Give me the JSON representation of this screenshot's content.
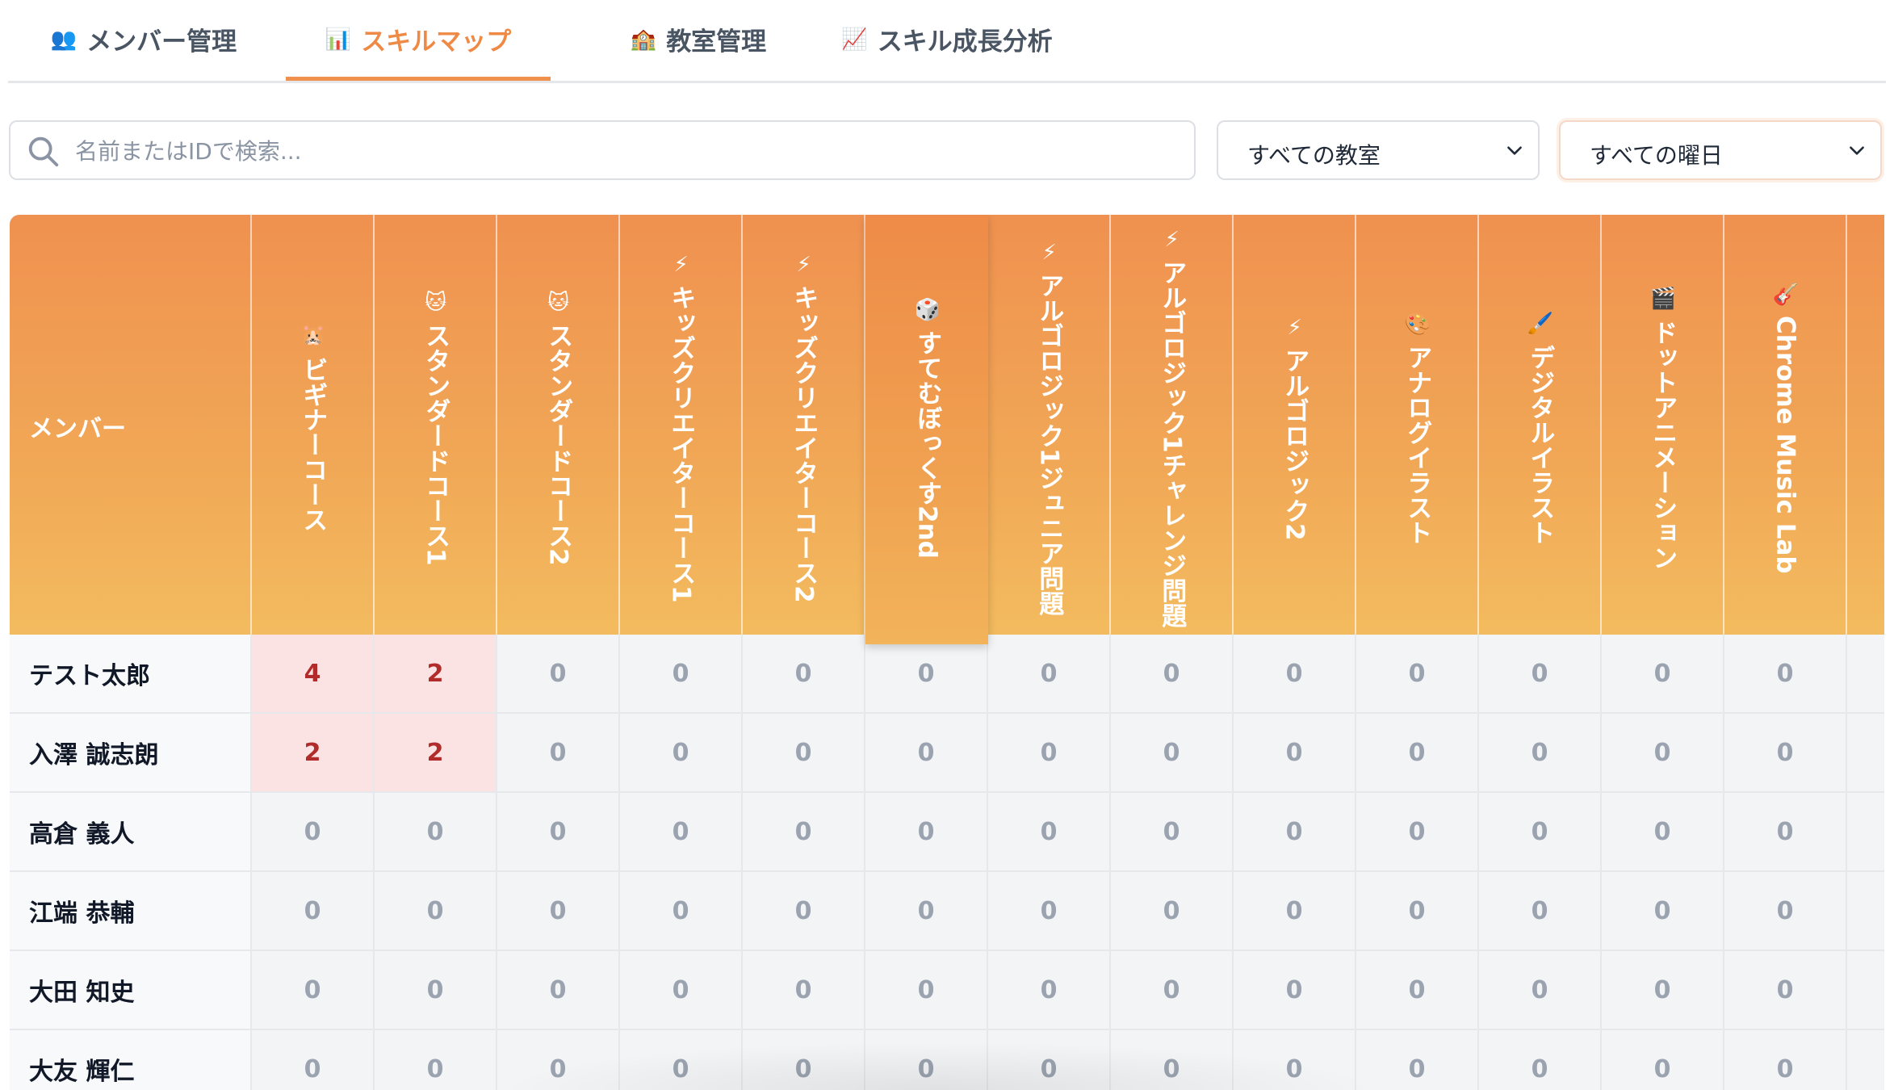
{
  "tabs": [
    {
      "icon": "👥",
      "label": "メンバー管理",
      "active": false
    },
    {
      "icon": "📊",
      "label": "スキルマップ",
      "active": true
    },
    {
      "icon": "🏫",
      "label": "教室管理",
      "active": false
    },
    {
      "icon": "📈",
      "label": "スキル成長分析",
      "active": false
    }
  ],
  "search": {
    "placeholder": "名前またはIDで検索..."
  },
  "filters": {
    "classroom": "すべての教室",
    "weekday": "すべての曜日"
  },
  "table": {
    "member_header": "メンバー",
    "skills": [
      {
        "label": "ビギナーコース",
        "emoji": "🐹"
      },
      {
        "label": "スタンダードコース1",
        "emoji": "🐱"
      },
      {
        "label": "スタンダードコース2",
        "emoji": "🐱"
      },
      {
        "label": "キッズクリエイターコース1",
        "emoji": "⚡"
      },
      {
        "label": "キッズクリエイターコース2",
        "emoji": "⚡"
      },
      {
        "label": "すてむぼっくす2nd",
        "emoji": "🎲"
      },
      {
        "label": "アルゴロジック1ジュニア問題",
        "emoji": "⚡"
      },
      {
        "label": "アルゴロジック1チャレンジ問題",
        "emoji": "⚡"
      },
      {
        "label": "アルゴロジック2",
        "emoji": "⚡"
      },
      {
        "label": "アナログイラスト",
        "emoji": "🎨"
      },
      {
        "label": "デジタルイラスト",
        "emoji": "🖌️"
      },
      {
        "label": "ドットアニメーション",
        "emoji": "🎬"
      },
      {
        "label": "Chrome Music Lab",
        "emoji": "🎸"
      }
    ],
    "rows": [
      {
        "name": "テスト太郎",
        "values": [
          "4",
          "2",
          "0",
          "0",
          "0",
          "0",
          "0",
          "0",
          "0",
          "0",
          "0",
          "0",
          "0"
        ]
      },
      {
        "name": "入澤 誠志朗",
        "values": [
          "2",
          "2",
          "0",
          "0",
          "0",
          "0",
          "0",
          "0",
          "0",
          "0",
          "0",
          "0",
          "0"
        ]
      },
      {
        "name": "高倉 義人",
        "values": [
          "0",
          "0",
          "0",
          "0",
          "0",
          "0",
          "0",
          "0",
          "0",
          "0",
          "0",
          "0",
          "0"
        ]
      },
      {
        "name": "江端 恭輔",
        "values": [
          "0",
          "0",
          "0",
          "0",
          "0",
          "0",
          "0",
          "0",
          "0",
          "0",
          "0",
          "0",
          "0"
        ]
      },
      {
        "name": "大田 知史",
        "values": [
          "0",
          "0",
          "0",
          "0",
          "0",
          "0",
          "0",
          "0",
          "0",
          "0",
          "0",
          "0",
          "0"
        ]
      },
      {
        "name": "大友 輝仁",
        "values": [
          "0",
          "0",
          "0",
          "0",
          "0",
          "0",
          "0",
          "0",
          "0",
          "0",
          "0",
          "0",
          "0"
        ]
      }
    ]
  }
}
